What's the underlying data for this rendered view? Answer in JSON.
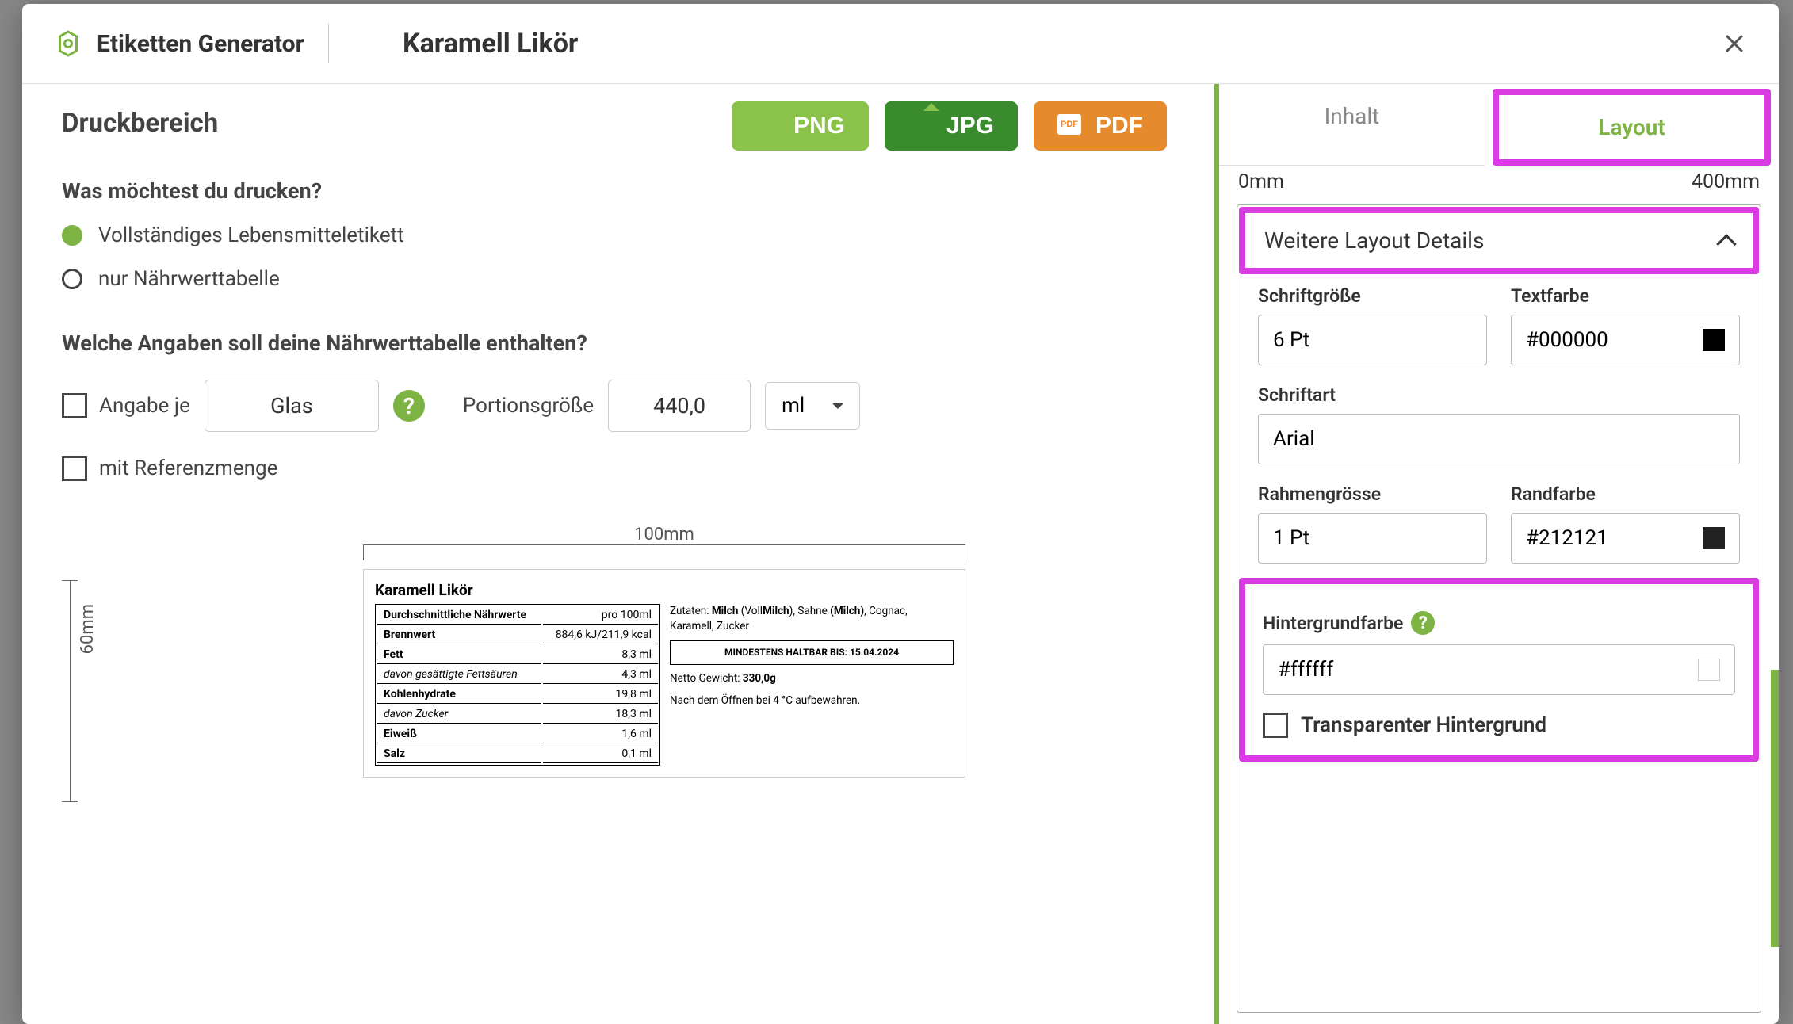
{
  "header": {
    "app_title": "Etiketten Generator",
    "doc_title": "Karamell Likör"
  },
  "left": {
    "section_title": "Druckbereich",
    "export": {
      "png": "PNG",
      "jpg": "JPG",
      "pdf": "PDF",
      "pdf_badge": "PDF"
    },
    "question1": "Was möchtest du drucken?",
    "radio1": "Vollständiges Lebensmitteletikett",
    "radio2": "nur Nährwerttabelle",
    "question2": "Welche Angaben soll deine Nährwerttabelle enthalten?",
    "angabe_je": "Angabe je",
    "glas": "Glas",
    "portion_label": "Portionsgröße",
    "portion_value": "440,0",
    "unit": "ml",
    "ref_label": "mit Referenzmenge",
    "ruler_top": "100mm",
    "ruler_left": "60mm"
  },
  "preview": {
    "title": "Karamell Likör",
    "thead_left": "Durchschnittliche Nährwerte",
    "thead_right": "pro 100ml",
    "rows": [
      {
        "k": "Brennwert",
        "v": "884,6 kJ/211,9 kcal"
      },
      {
        "k": "Fett",
        "v": "8,3 ml"
      },
      {
        "k": "davon gesättigte Fettsäuren",
        "v": "4,3 ml",
        "sub": true
      },
      {
        "k": "Kohlenhydrate",
        "v": "19,8 ml"
      },
      {
        "k": "davon Zucker",
        "v": "18,3 ml",
        "sub": true
      },
      {
        "k": "Eiweiß",
        "v": "1,6 ml"
      },
      {
        "k": "Salz",
        "v": "0,1 ml"
      }
    ],
    "ingredients_pre": "Zutaten: ",
    "ingredients_html": "Milch (VollMilch), Sahne (Milch), Cognac, Karamell, Zucker",
    "bbf_label": "MINDESTENS HALTBAR BIS: ",
    "bbf_date": "15.04.2024",
    "netweight_label": "Netto Gewicht: ",
    "netweight": "330,0g",
    "storage": "Nach dem Öffnen bei 4 °C aufbewahren."
  },
  "right": {
    "tab_content": "Inhalt",
    "tab_layout": "Layout",
    "range_min": "0mm",
    "range_max": "400mm",
    "accordion_title": "Weitere Layout Details",
    "fontsize_label": "Schriftgröße",
    "fontsize": "6 Pt",
    "textcolor_label": "Textfarbe",
    "textcolor": "#000000",
    "fontfamily_label": "Schriftart",
    "fontfamily": "Arial",
    "border_label": "Rahmengrösse",
    "border": "1 Pt",
    "bordercolor_label": "Randfarbe",
    "bordercolor": "#212121",
    "bg_label": "Hintergrundfarbe",
    "bg": "#ffffff",
    "transparent_label": "Transparenter Hintergrund"
  }
}
